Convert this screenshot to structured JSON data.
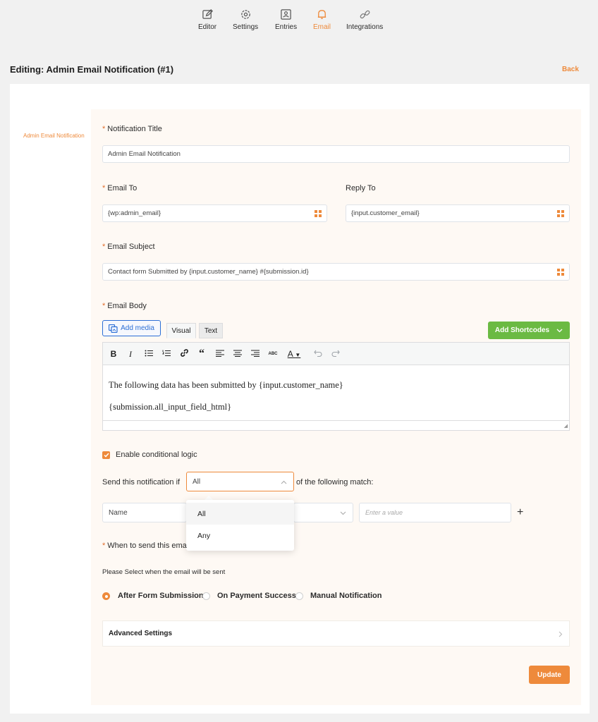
{
  "nav": {
    "editor": "Editor",
    "settings": "Settings",
    "entries": "Entries",
    "email": "Email",
    "integrations": "Integrations"
  },
  "page": {
    "title": "Editing: Admin Email Notification (#1)",
    "back": "Back",
    "sidebar_item": "Admin Email Notification"
  },
  "form": {
    "notification_title_label": "Notification Title",
    "notification_title_value": "Admin Email Notification",
    "email_to_label": "Email To",
    "email_to_value": "{wp:admin_email}",
    "reply_to_label": "Reply To",
    "reply_to_value": "{input.customer_email}",
    "email_subject_label": "Email Subject",
    "email_subject_value": "Contact form Submitted by {input.customer_name} #{submission.id}",
    "email_body_label": "Email Body",
    "add_media": "Add media",
    "tab_visual": "Visual",
    "tab_text": "Text",
    "add_shortcodes": "Add Shortcodes",
    "body_line1": "The following data has been submitted by {input.customer_name}",
    "body_line2": "{submission.all_input_field_html}",
    "required_mark": "*"
  },
  "conditional": {
    "enable_label": "Enable conditional logic",
    "send_prefix": "Send this notification if",
    "match_selected": "All",
    "send_suffix": "of the following match:",
    "field_value": "Name",
    "value_placeholder": "Enter a value",
    "options": [
      "All",
      "Any"
    ]
  },
  "when": {
    "label": "When to send this ema",
    "hint": "Please Select when the email will be sent",
    "options": [
      "After Form Submission",
      "On Payment Success",
      "Manual Notification"
    ],
    "selected_index": 0
  },
  "advanced_settings": "Advanced Settings",
  "update_button": "Update",
  "colors": {
    "accent": "#ee8a3b",
    "green": "#6bba43",
    "link_blue": "#2c6fd6"
  }
}
